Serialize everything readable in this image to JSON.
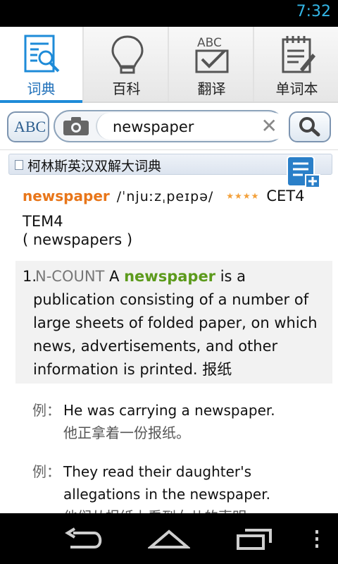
{
  "status": {
    "time": "7:32"
  },
  "tabs": [
    {
      "label": "词典",
      "icon": "dictionary-search-icon",
      "active": true
    },
    {
      "label": "百科",
      "icon": "lightbulb-icon",
      "active": false
    },
    {
      "label": "翻译",
      "icon": "abc-check-icon",
      "active": false
    },
    {
      "label": "单词本",
      "icon": "notebook-icon",
      "active": false
    }
  ],
  "search": {
    "abc_label": "ABC",
    "query": "newspaper",
    "clear_label": "✕"
  },
  "dict": {
    "title": "柯林斯英汉双解大词典"
  },
  "entry": {
    "headword": "newspaper",
    "phonetic": "/ˈnjuːzˌpeɪpə/",
    "stars": "★★★★",
    "tags": "CET4",
    "tags2": "TEM4",
    "inflection": "( newspapers )"
  },
  "sense": {
    "num": "1.",
    "grammar": "N-COUNT",
    "pre": " A ",
    "keyword": "newspaper",
    "text": " is a publication consisting of a number of large sheets of folded paper, on which news, advertisements, and other information is printed. 报纸"
  },
  "examples": [
    {
      "tag": "例：",
      "en": "He was carrying a newspaper.",
      "zh": "他正拿着一份报纸。"
    },
    {
      "tag": "例：",
      "en": "They read their daughter's allegations in the newspaper.",
      "zh": "他们从报纸上看到女儿的声明。"
    }
  ]
}
